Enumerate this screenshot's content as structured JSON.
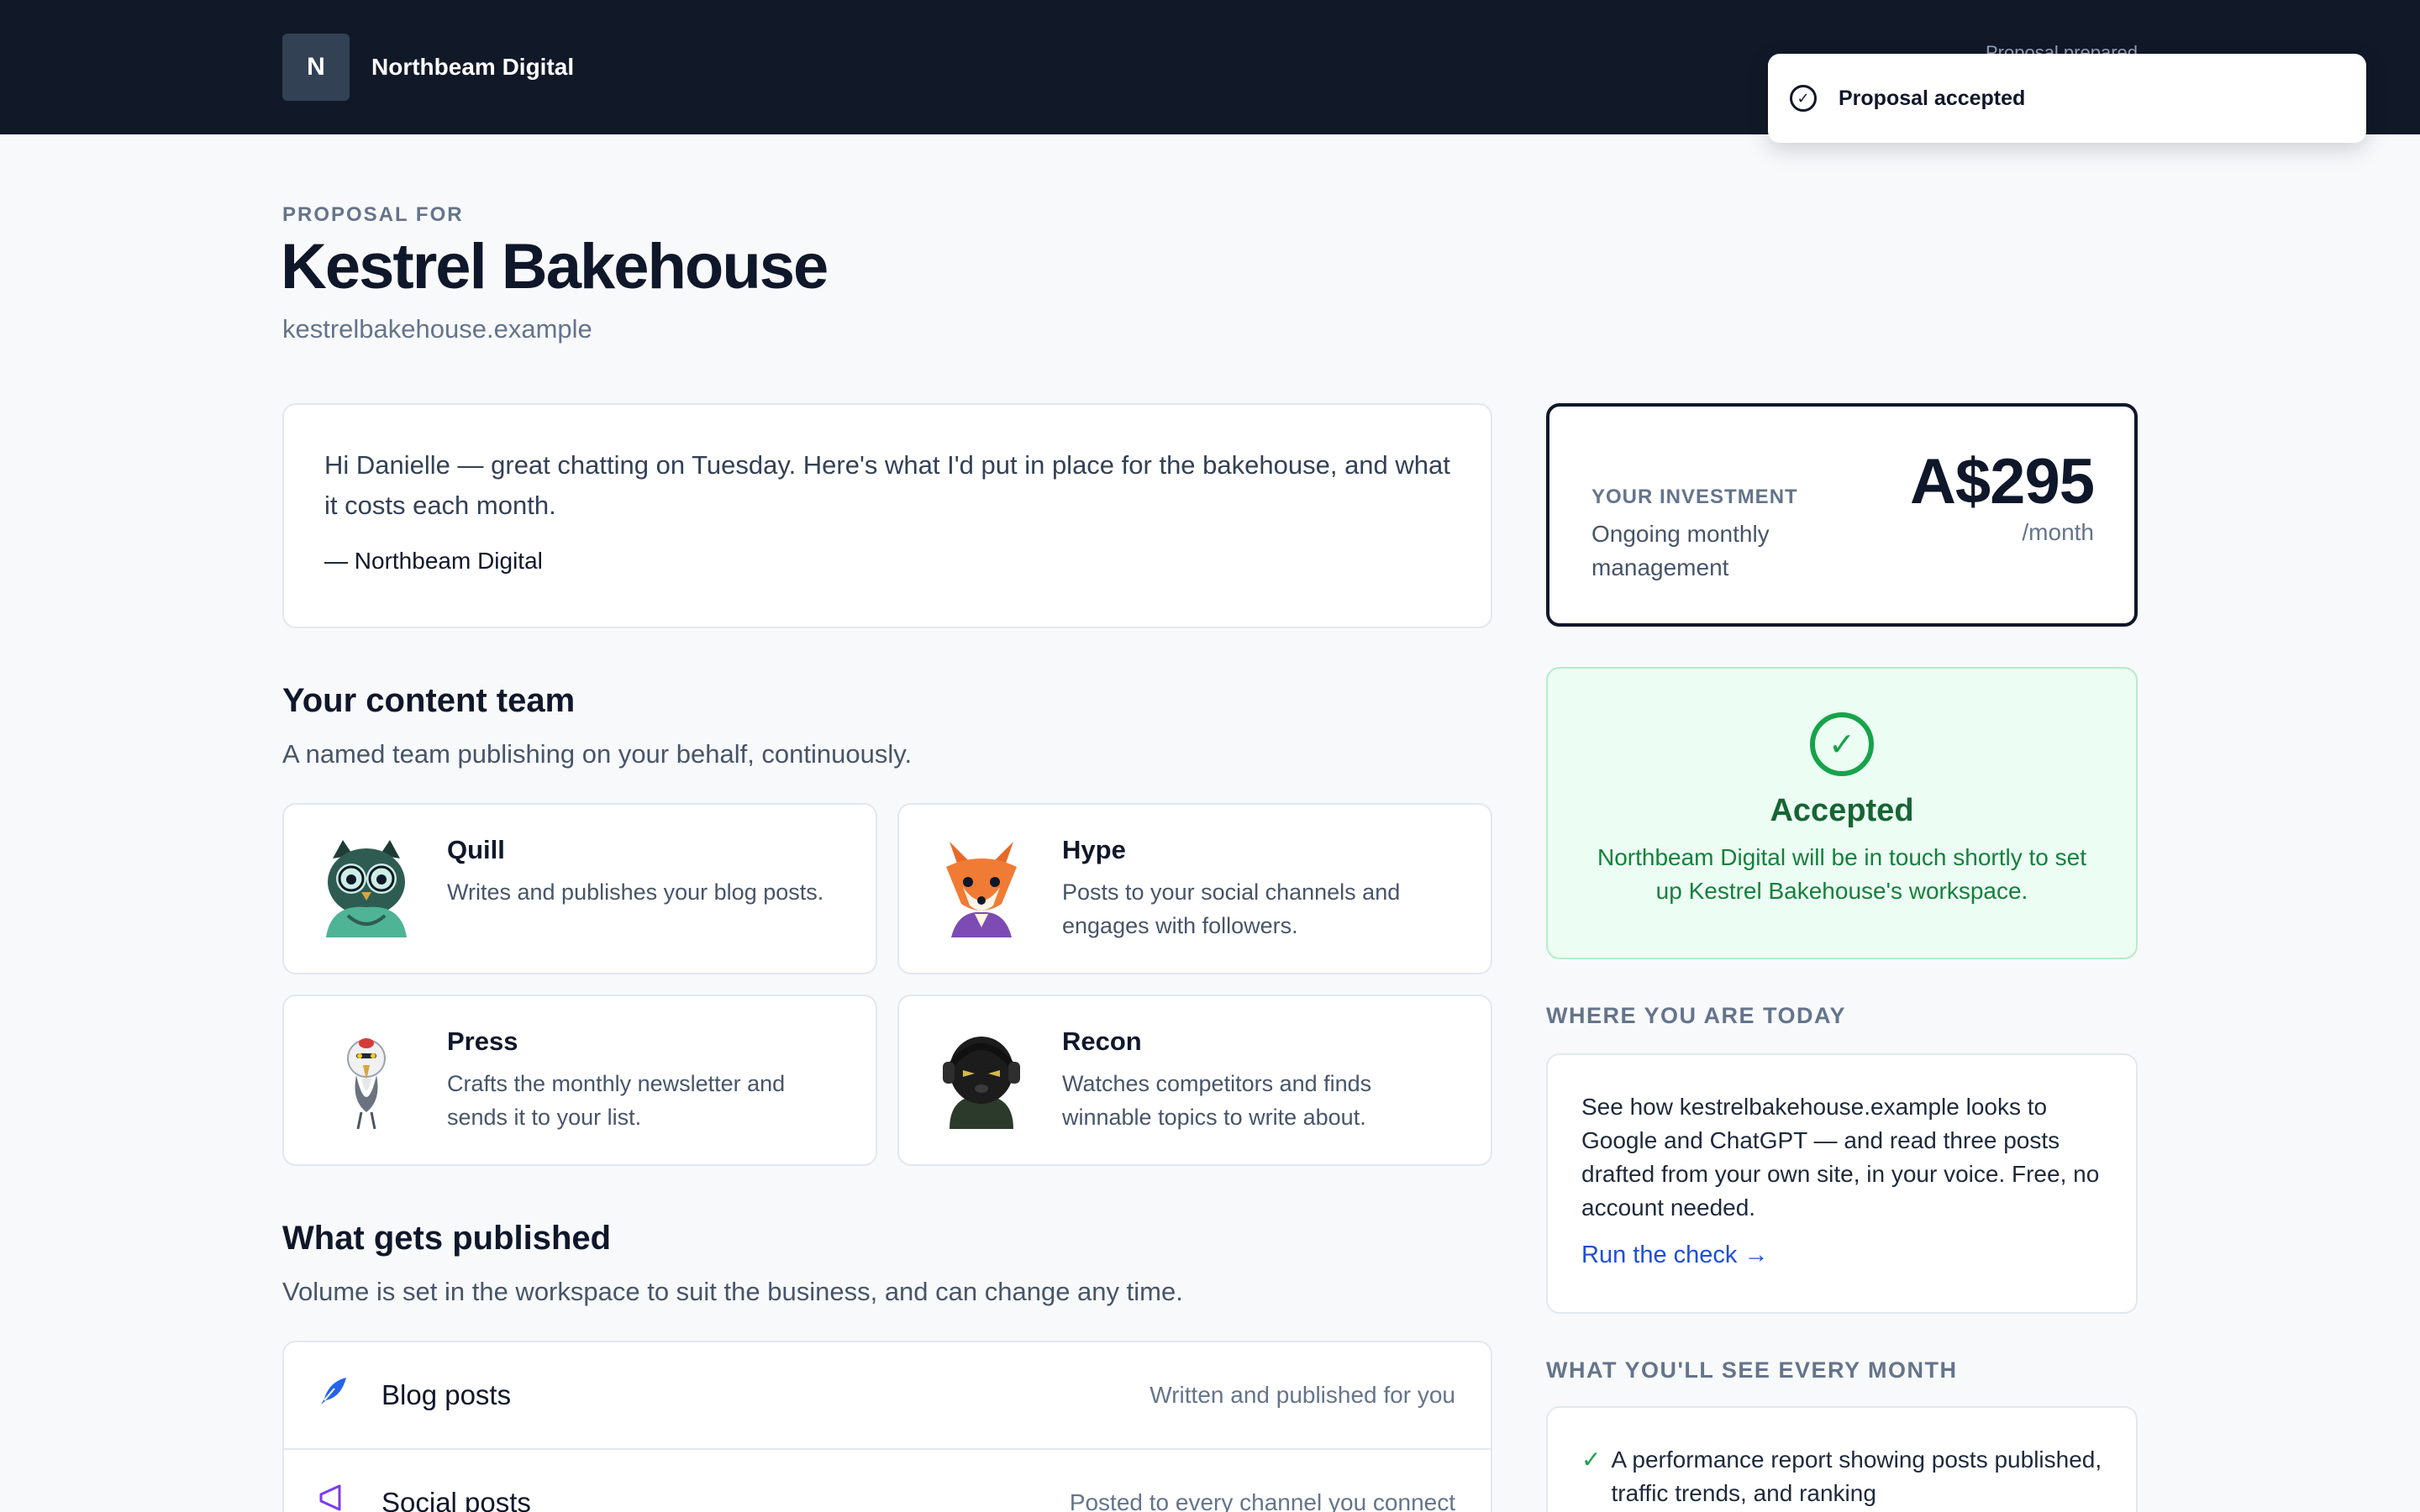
{
  "header": {
    "brand_initial": "N",
    "brand_name": "Northbeam Digital",
    "prepared_label": "Proposal prepared"
  },
  "toast": {
    "icon": "check-circle-icon",
    "message": "Proposal accepted"
  },
  "proposal": {
    "eyebrow": "PROPOSAL FOR",
    "client_name": "Kestrel Bakehouse",
    "client_site": "kestrelbakehouse.example"
  },
  "intro": {
    "message": "Hi Danielle — great chatting on Tuesday. Here's what I'd put in place for the bakehouse, and what it costs each month.",
    "signature": "— Northbeam Digital"
  },
  "team": {
    "title": "Your content team",
    "subtitle": "A named team publishing on your behalf, continuously.",
    "members": [
      {
        "name": "Quill",
        "desc": "Writes and publishes your blog posts.",
        "avatar": "owl-icon"
      },
      {
        "name": "Hype",
        "desc": "Posts to your social channels and engages with followers.",
        "avatar": "fox-icon"
      },
      {
        "name": "Press",
        "desc": "Crafts the monthly newsletter and sends it to your list.",
        "avatar": "crane-icon"
      },
      {
        "name": "Recon",
        "desc": "Watches competitors and finds winnable topics to write about.",
        "avatar": "panther-icon"
      }
    ]
  },
  "published": {
    "title": "What gets published",
    "subtitle": "Volume is set in the workspace to suit the business, and can change any time.",
    "items": [
      {
        "label": "Blog posts",
        "note": "Written and published for you",
        "icon": "quill-icon",
        "color": "#2563eb"
      },
      {
        "label": "Social posts",
        "note": "Posted to every channel you connect",
        "icon": "megaphone-icon",
        "color": "#7c3aed"
      }
    ]
  },
  "investment": {
    "label": "YOUR INVESTMENT",
    "desc": "Ongoing monthly management",
    "price": "A$295",
    "per": "/month"
  },
  "accepted": {
    "icon": "check-circle-icon",
    "title": "Accepted",
    "text": "Northbeam Digital will be in touch shortly to set up Kestrel Bakehouse's workspace."
  },
  "today": {
    "heading": "WHERE YOU ARE TODAY",
    "text": "See how kestrelbakehouse.example looks to Google and ChatGPT — and read three posts drafted from your own site, in your voice. Free, no account needed.",
    "link": "Run the check →"
  },
  "monthly": {
    "heading": "WHAT YOU'LL SEE EVERY MONTH",
    "items": [
      "A performance report showing posts published, traffic trends, and ranking"
    ]
  },
  "colors": {
    "header_bg": "#111827",
    "accent_green": "#16a34a",
    "link_blue": "#1d4ed8"
  }
}
